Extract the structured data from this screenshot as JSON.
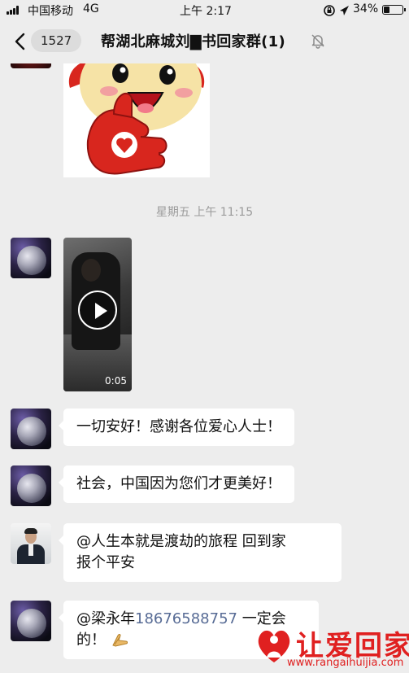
{
  "status_bar": {
    "carrier": "中国移动",
    "network": "4G",
    "time": "上午 2:17",
    "battery_percent": "34%",
    "battery_level": 0.34
  },
  "nav": {
    "back_count": "1527",
    "title": "帮湖北麻城刘▇书回家群(1)"
  },
  "chat": {
    "timestamp": "星期五 上午 11:15",
    "video": {
      "duration": "0:05"
    },
    "messages": [
      {
        "text": "一切安好！感谢各位爱心人士！"
      },
      {
        "text": "社会，中国因为您们才更美好！"
      },
      {
        "line1": "@人生本就是渡劫的旅程  回到家",
        "line2": "报个平安"
      },
      {
        "prefix": "@梁永年",
        "phone": "18676588757",
        "suffix": "一定会",
        "line2": "的！"
      }
    ]
  },
  "watermark": {
    "text": "让爱回家",
    "url": "www.rangaihuijia.com"
  },
  "colors": {
    "background": "#ededed",
    "bubble": "#ffffff",
    "link": "#576b95",
    "watermark": "#e02020"
  }
}
